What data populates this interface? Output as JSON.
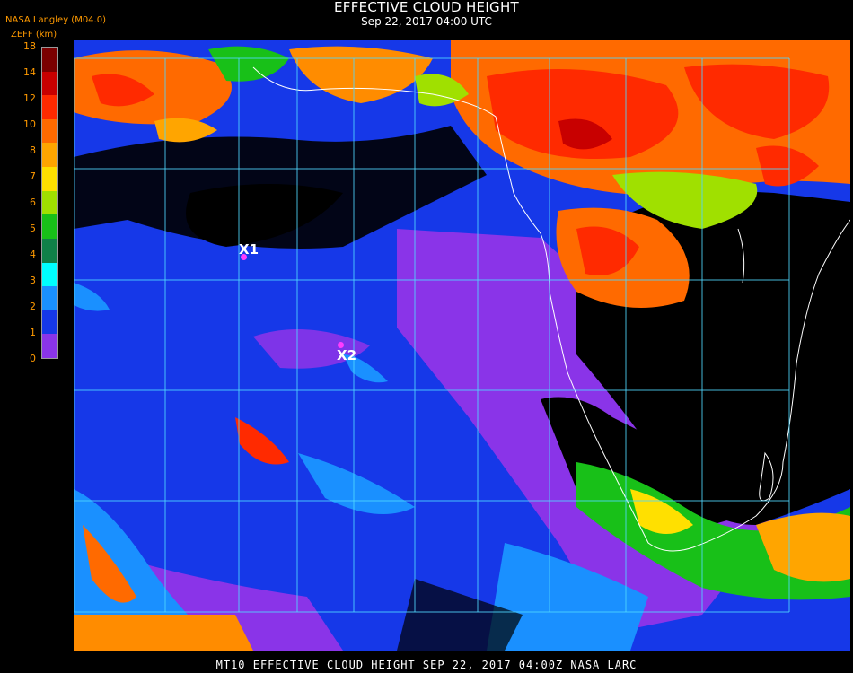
{
  "header": {
    "title": "EFFECTIVE CLOUD HEIGHT",
    "subtitle": "Sep 22, 2017 04:00 UTC",
    "organization": "NASA Langley (M04.0)",
    "units_label": "ZEFF (km)"
  },
  "legend": {
    "ticks": [
      "18",
      "14",
      "12",
      "10",
      "8",
      "7",
      "6",
      "5",
      "4",
      "3",
      "2",
      "1",
      "0"
    ],
    "colors": [
      "#7a0000",
      "#c80000",
      "#ff2a00",
      "#ff6a00",
      "#ffa500",
      "#ffe000",
      "#a0e000",
      "#18c018",
      "#108048",
      "#00ffff",
      "#1a90ff",
      "#1638e8",
      "#8a34e8"
    ],
    "background_color": "#000000"
  },
  "map": {
    "points": [
      {
        "label": "X1"
      },
      {
        "label": "X2"
      }
    ],
    "grid_color": "#50d8ff",
    "coastline_color": "#ffffff"
  },
  "footer": {
    "text": "MT10  EFFECTIVE CLOUD HEIGHT  SEP 22, 2017 04:00Z  NASA LARC"
  }
}
